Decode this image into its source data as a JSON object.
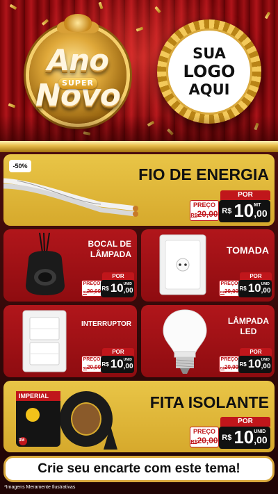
{
  "header": {
    "title_line1": "Ano",
    "title_super": "SUPER",
    "title_line2": "Novo",
    "logo_lines": [
      "SUA",
      "LOGO",
      "AQUI"
    ]
  },
  "products": {
    "fio": {
      "name": "FIO DE ENERGIA",
      "discount": "-50%",
      "por_label": "POR",
      "preco_label": "PREÇO",
      "old_prefix": "R$",
      "old_price": "20,00",
      "currency": "R$",
      "price_int": "10",
      "price_dec": ",00",
      "unit": "MT"
    },
    "bocal": {
      "name_line1": "BOCAL DE",
      "name_line2": "LÂMPADA",
      "por_label": "POR",
      "preco_label": "PREÇO",
      "old_prefix": "R$",
      "old_price": "20,00",
      "currency": "R$",
      "price_int": "10",
      "price_dec": ",00",
      "unit": "UNID"
    },
    "tomada": {
      "name": "TOMADA",
      "por_label": "POR",
      "preco_label": "PREÇO",
      "old_prefix": "R$",
      "old_price": "20,00",
      "currency": "R$",
      "price_int": "10",
      "price_dec": ",00",
      "unit": "UNID"
    },
    "interruptor": {
      "name": "INTERRUPTOR",
      "por_label": "POR",
      "preco_label": "PREÇO",
      "old_prefix": "R$",
      "old_price": "20,00",
      "currency": "R$",
      "price_int": "10",
      "price_dec": ",00",
      "unit": "UNID"
    },
    "lampada": {
      "name_line1": "LÂMPADA",
      "name_line2": "LED",
      "por_label": "POR",
      "preco_label": "PREÇO",
      "old_prefix": "R$",
      "old_price": "20,00",
      "currency": "R$",
      "price_int": "10",
      "price_dec": ",00",
      "unit": "UNID"
    },
    "fita": {
      "name": "FITA ISOLANTE",
      "por_label": "POR",
      "preco_label": "PREÇO",
      "old_prefix": "R$",
      "old_price": "20,00",
      "currency": "R$",
      "price_int": "10",
      "price_dec": ",00",
      "unit": "UNID",
      "brand": "IMPERIAL",
      "sub_brand": "3M"
    }
  },
  "cta": "Crie seu encarte com este tema!",
  "disclaimer": "*Imagens Meramente Ilustrativas",
  "colors": {
    "red": "#b1161b",
    "gold": "#e9c547",
    "black": "#111111"
  }
}
